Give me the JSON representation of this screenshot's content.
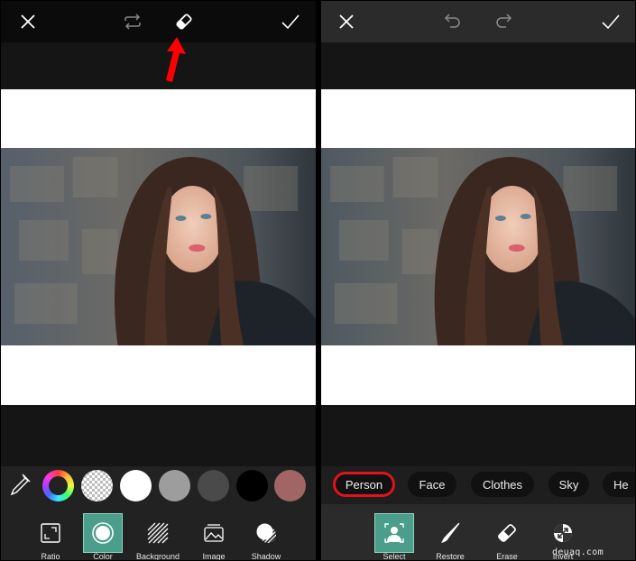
{
  "left_panel": {
    "topbar": {
      "close_icon": "close-icon",
      "flip_icon": "swap-arrows-icon",
      "eraser_icon": "eraser-icon",
      "apply_icon": "checkmark-icon"
    },
    "annotation": {
      "arrow_color": "#ff0000",
      "points_to": "eraser-icon"
    },
    "swatches": [
      {
        "name": "color-wheel",
        "color": "spectrum"
      },
      {
        "name": "transparent",
        "color": "transparent"
      },
      {
        "name": "white",
        "color": "#ffffff"
      },
      {
        "name": "light-gray",
        "color": "#9d9d9d"
      },
      {
        "name": "dark-gray",
        "color": "#4a4a4a"
      },
      {
        "name": "black",
        "color": "#000000"
      },
      {
        "name": "rose",
        "color": "#a16565"
      }
    ],
    "tools": [
      {
        "label": "Ratio",
        "icon": "ratio-icon",
        "active": false
      },
      {
        "label": "Color",
        "icon": "color-circle-icon",
        "active": true
      },
      {
        "label": "Background",
        "icon": "background-stripes-icon",
        "active": false
      },
      {
        "label": "Image",
        "icon": "image-icon",
        "active": false
      },
      {
        "label": "Shadow",
        "icon": "shadow-icon",
        "active": false
      }
    ],
    "accent_color": "#4a9e8a"
  },
  "right_panel": {
    "topbar": {
      "close_icon": "close-icon",
      "undo_icon": "undo-icon",
      "redo_icon": "redo-icon",
      "apply_icon": "checkmark-icon"
    },
    "chips": [
      {
        "label": "Person",
        "highlighted": true
      },
      {
        "label": "Face",
        "highlighted": false
      },
      {
        "label": "Clothes",
        "highlighted": false
      },
      {
        "label": "Sky",
        "highlighted": false
      },
      {
        "label": "He",
        "highlighted": false
      }
    ],
    "highlight_color": "#e0121b",
    "tools": [
      {
        "label": "Select",
        "icon": "select-person-icon",
        "active": true
      },
      {
        "label": "Restore",
        "icon": "brush-icon",
        "active": false
      },
      {
        "label": "Erase",
        "icon": "eraser-icon",
        "active": false
      },
      {
        "label": "Invert",
        "icon": "invert-icon",
        "active": false
      }
    ],
    "watermark": "deuaq.com"
  }
}
